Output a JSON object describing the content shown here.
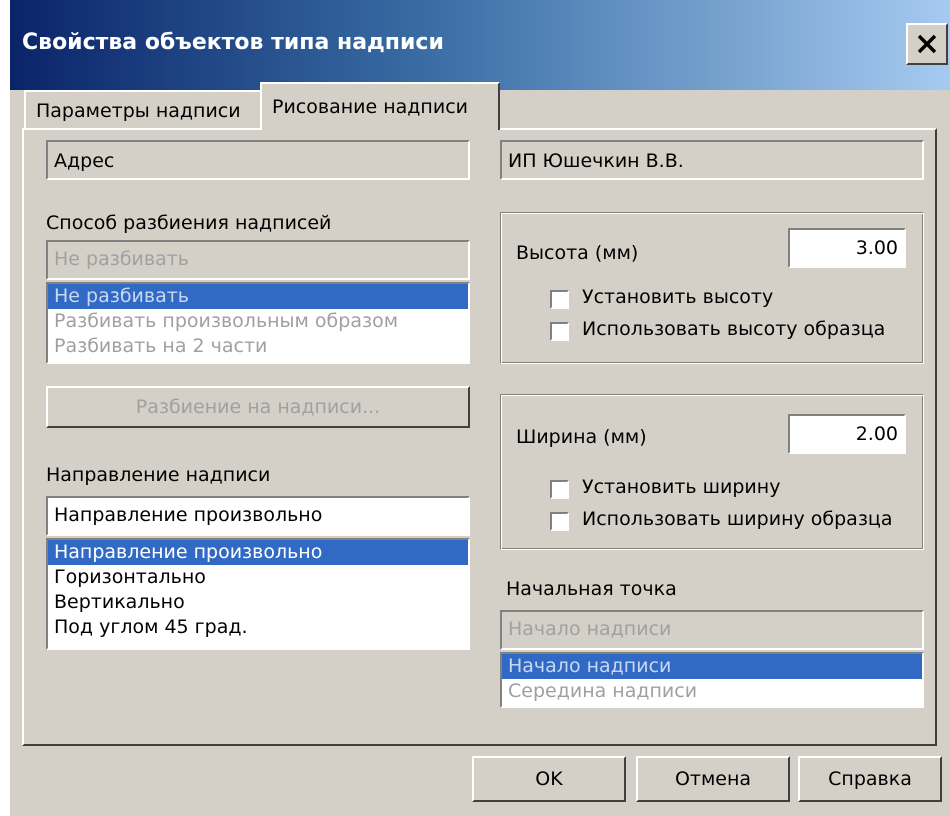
{
  "window": {
    "title": "Свойства объектов типа надписи"
  },
  "tabs": [
    {
      "label": "Параметры надписи",
      "active": false
    },
    {
      "label": "Рисование надписи",
      "active": true
    }
  ],
  "left": {
    "field1": "Адрес",
    "split_label": "Способ разбиения надписей",
    "split_combo_value": "Не разбивать",
    "split_options": [
      "Не разбивать",
      "Разбивать произвольным образом",
      "Разбивать на 2 части"
    ],
    "split_button": "Разбиение на надписи...",
    "direction_label": "Направление надписи",
    "direction_combo_value": "Направление произвольно",
    "direction_options": [
      "Направление произвольно",
      "Горизонтально",
      "Вертикально",
      "Под углом 45 град."
    ]
  },
  "right": {
    "field2": "ИП Юшечкин В.В.",
    "height_label": "Высота (мм)",
    "height_value": "3.00",
    "set_height": "Установить высоту",
    "use_sample_height": "Использовать высоту образца",
    "width_label": "Ширина (мм)",
    "width_value": "2.00",
    "set_width": "Установить ширину",
    "use_sample_width": "Использовать ширину образца",
    "start_label": "Начальная точка",
    "start_combo_value": "Начало надписи",
    "start_options": [
      "Начало надписи",
      "Середина надписи"
    ]
  },
  "buttons": {
    "ok": "OK",
    "cancel": "Отмена",
    "help": "Справка"
  }
}
